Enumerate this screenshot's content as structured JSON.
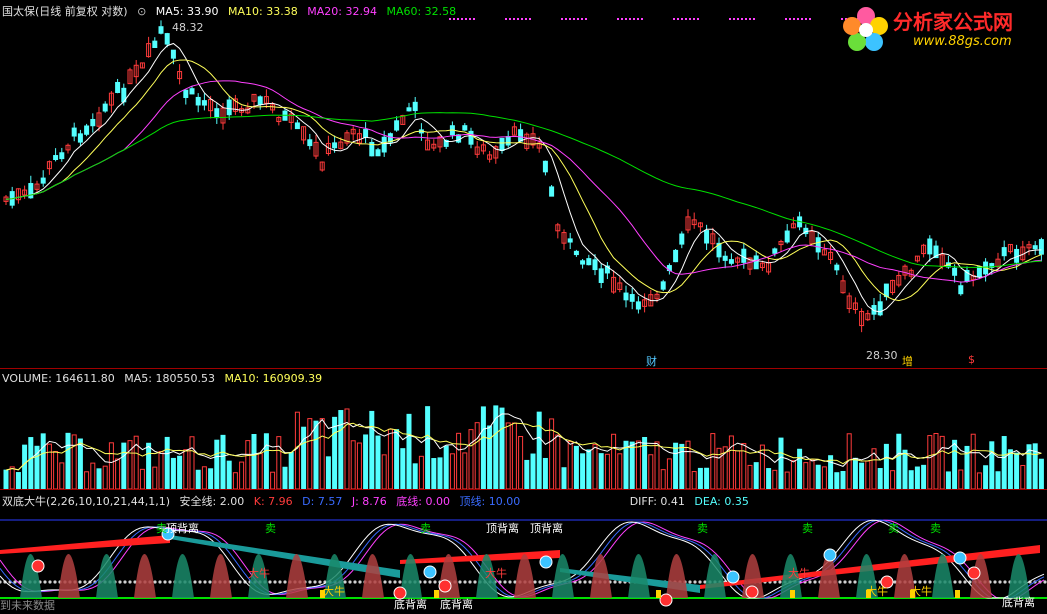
{
  "price_header": {
    "symbol": "国太保(日线 前复权 对数)",
    "ma5": "MA5: 33.90",
    "ma10": "MA10: 33.38",
    "ma20": "MA20: 32.94",
    "ma60": "MA60: 32.58"
  },
  "price_labels": {
    "high": "48.32",
    "low": "28.30",
    "event_cai": "财",
    "event_zeng": "增",
    "event_dollar": "$"
  },
  "volume_header": {
    "volume": "VOLUME: 164611.80",
    "ma5": "MA5: 180550.53",
    "ma10": "MA10: 160909.39"
  },
  "indicator_header": {
    "name": "双底大牛(2,26,10,10,21,44,1,1)",
    "safe_line": "安全线: 2.00",
    "k": "K: 7.96",
    "d": "D: 7.57",
    "j": "J: 8.76",
    "bottom_line": "底线: 0.00",
    "top_line": "顶线: 10.00",
    "diff": "DIFF: 0.41",
    "dea": "DEA: 0.35"
  },
  "indicator_labels": {
    "top_div_1": "顶背离",
    "top_div_2": "顶背离",
    "top_div_3": "顶背离",
    "bottom_div_1": "底背离",
    "bottom_div_2": "底背离",
    "bottom_div_3": "底背离",
    "sell_1": "卖",
    "sell_2": "卖",
    "sell_3": "卖",
    "sell_4": "卖",
    "sell_5": "卖",
    "sell_6": "卖",
    "sell_7": "卖",
    "bull_1": "大牛",
    "bull_2": "大牛",
    "bull_3": "大牛",
    "bull_4": "大牛",
    "bull_5": "大牛",
    "bull_6": "大牛"
  },
  "bottom_note": "到未来数据",
  "logo": {
    "title": "分析家公式网",
    "url": "www.88gs.com"
  },
  "colors": {
    "up": "#ff3b3b",
    "down": "#54ffff",
    "ma5": "#ffffff",
    "ma10": "#ffff5a",
    "ma20": "#ff40ff",
    "ma60": "#00e000"
  }
}
